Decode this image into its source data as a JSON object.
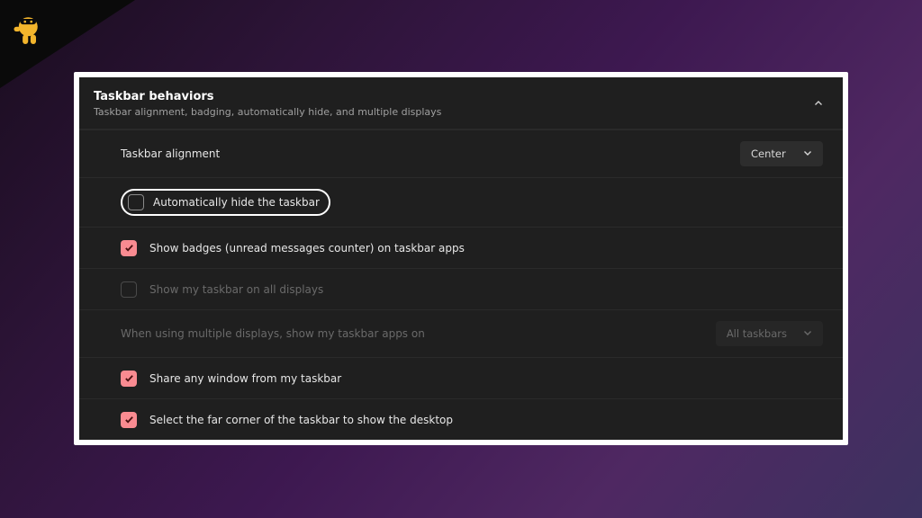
{
  "section": {
    "title": "Taskbar behaviors",
    "subtitle": "Taskbar alignment, badging, automatically hide, and multiple displays"
  },
  "alignment": {
    "label": "Taskbar alignment",
    "value": "Center"
  },
  "items": {
    "auto_hide": {
      "label": "Automatically hide the taskbar",
      "checked": false,
      "highlighted": true
    },
    "badges": {
      "label": "Show badges (unread messages counter) on taskbar apps",
      "checked": true
    },
    "all_disp": {
      "label": "Show my taskbar on all displays",
      "checked": false,
      "disabled": true
    },
    "multi": {
      "label": "When using multiple displays, show my taskbar apps on",
      "value": "All taskbars",
      "disabled": true
    },
    "share": {
      "label": "Share any window from my taskbar",
      "checked": true
    },
    "far_corner": {
      "label": "Select the far corner of the taskbar to show the desktop",
      "checked": true
    }
  },
  "icons": {
    "check": "✓"
  }
}
